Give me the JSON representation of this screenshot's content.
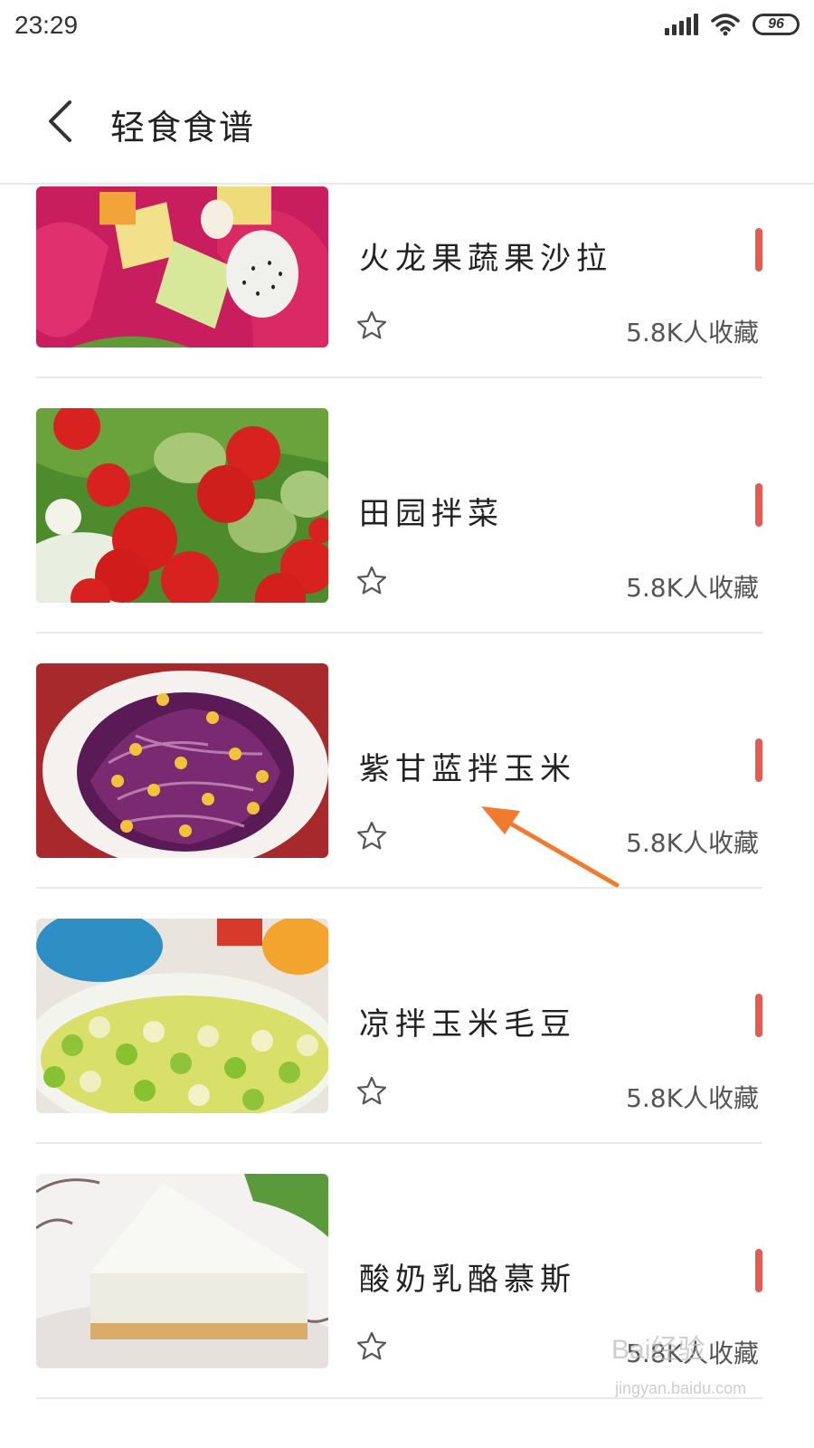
{
  "status_bar": {
    "time": "23:29",
    "battery": "96",
    "icons": [
      "signal-icon",
      "wifi-icon",
      "battery-icon"
    ]
  },
  "header": {
    "title": "轻食食谱",
    "back_icon": "chevron-left-icon"
  },
  "recipes": [
    {
      "name": "火龙果蔬果沙拉",
      "favorites": "5.8K人收藏",
      "image": "dragon-fruit-salad",
      "star_icon": "star-outline-icon"
    },
    {
      "name": "田园拌菜",
      "favorites": "5.8K人收藏",
      "image": "garden-salad",
      "star_icon": "star-outline-icon"
    },
    {
      "name": "紫甘蓝拌玉米",
      "favorites": "5.8K人收藏",
      "image": "purple-cabbage-corn",
      "star_icon": "star-outline-icon"
    },
    {
      "name": "凉拌玉米毛豆",
      "favorites": "5.8K人收藏",
      "image": "corn-edamame",
      "star_icon": "star-outline-icon"
    },
    {
      "name": "酸奶乳酪慕斯",
      "favorites": "5.8K人收藏",
      "image": "yogurt-cheese-mousse",
      "star_icon": "star-outline-icon"
    }
  ],
  "colors": {
    "accent_mark": "#e55a52",
    "annotation_arrow": "#f07a2e",
    "divider": "#e8e8e8"
  },
  "watermark": {
    "brand": "Bai经验",
    "url": "jingyan.baidu.com"
  }
}
